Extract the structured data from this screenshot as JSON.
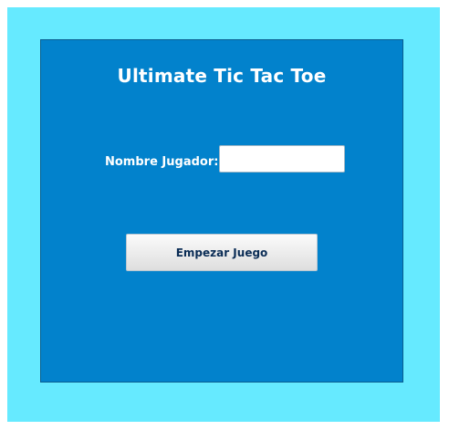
{
  "app": {
    "title": "Ultimate Tic Tac Toe"
  },
  "form": {
    "player_name_label": "Nombre Jugador:",
    "player_name_value": "",
    "player_name_placeholder": "",
    "start_button_label": "Empezar Juego"
  },
  "colors": {
    "outer_background": "#66eaff",
    "panel_background": "#0282cc",
    "button_text": "#0a2c55"
  }
}
